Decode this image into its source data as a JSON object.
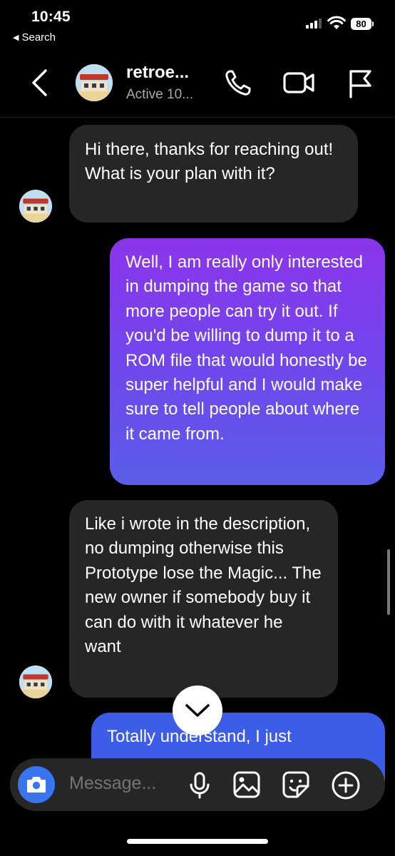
{
  "status_bar": {
    "time": "10:45",
    "back_label": "Search",
    "battery": "80"
  },
  "header": {
    "contact_name": "retroe...",
    "status": "Active 10..."
  },
  "messages": [
    {
      "direction": "incoming",
      "text": "Hi there, thanks for reaching out! What is your plan with it?"
    },
    {
      "direction": "outgoing",
      "text": "Well, I am really only interested in dumping the game so that more people can try it out.  If you'd be willing to dump it to a ROM file that would honestly be super helpful and I would make sure to tell people about where it came from."
    },
    {
      "direction": "incoming",
      "text": "Like i wrote in the description, no dumping otherwise this Prototype lose the Magic... The new owner if somebody buy it can do with it whatever he want"
    },
    {
      "direction": "outgoing",
      "text": "Totally understand, I just"
    }
  ],
  "composer": {
    "placeholder": "Message..."
  },
  "icons": {
    "back": "chevron-left-icon",
    "call": "phone-icon",
    "video": "video-camera-icon",
    "report": "flag-icon",
    "scroll": "chevron-down-icon",
    "camera": "camera-icon",
    "mic": "microphone-icon",
    "gallery": "image-icon",
    "sticker": "sticker-icon",
    "more": "plus-circle-icon"
  },
  "colors": {
    "background": "#000000",
    "incoming_bubble": "#262626",
    "outgoing_gradient_top": "#8b35ea",
    "outgoing_gradient_bottom": "#5a5dea",
    "outgoing_latest": "#3d5de8",
    "accent": "#3a75f0"
  }
}
